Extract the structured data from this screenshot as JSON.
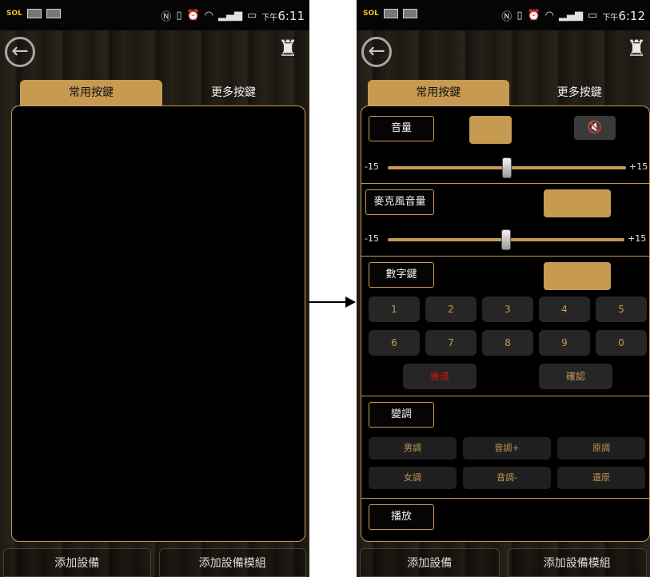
{
  "left_screen": {
    "status": {
      "carrier": "SOL",
      "time_prefix": "下午",
      "time": "6:11"
    },
    "tabs": [
      "常用按鍵",
      "更多按鍵"
    ],
    "bottom": [
      "添加設備",
      "添加設備模組"
    ]
  },
  "right_screen": {
    "status": {
      "carrier": "SOL",
      "time_prefix": "下午",
      "time": "6:12"
    },
    "tabs": [
      "常用按鍵",
      "更多按鍵"
    ],
    "volume": {
      "label": "音量",
      "slider_min": "-15",
      "slider_max": "+15",
      "value_fraction": 0.5
    },
    "mic_volume": {
      "label": "麥克風音量",
      "slider_min": "-15",
      "slider_max": "+15",
      "value_fraction": 0.5
    },
    "numpad": {
      "label": "數字鍵",
      "keys": [
        "1",
        "2",
        "3",
        "4",
        "5",
        "6",
        "7",
        "8",
        "9",
        "0"
      ],
      "back": "後退",
      "confirm": "確認"
    },
    "pitch": {
      "label": "變調",
      "buttons": [
        "男調",
        "音調+",
        "原調",
        "女調",
        "音調-",
        "還原"
      ]
    },
    "play": {
      "label": "播放"
    },
    "bottom": [
      "添加設備",
      "添加設備模組"
    ]
  },
  "colors": {
    "accent": "#c79a52",
    "back_key": "#e01010",
    "panel": "#000000"
  },
  "icons": [
    "back-arrow-icon",
    "alarm-icon",
    "mute-icon",
    "nfc-icon",
    "vibrate-icon",
    "alarm-clock-icon",
    "wifi-icon",
    "signal-icon",
    "battery-icon"
  ]
}
